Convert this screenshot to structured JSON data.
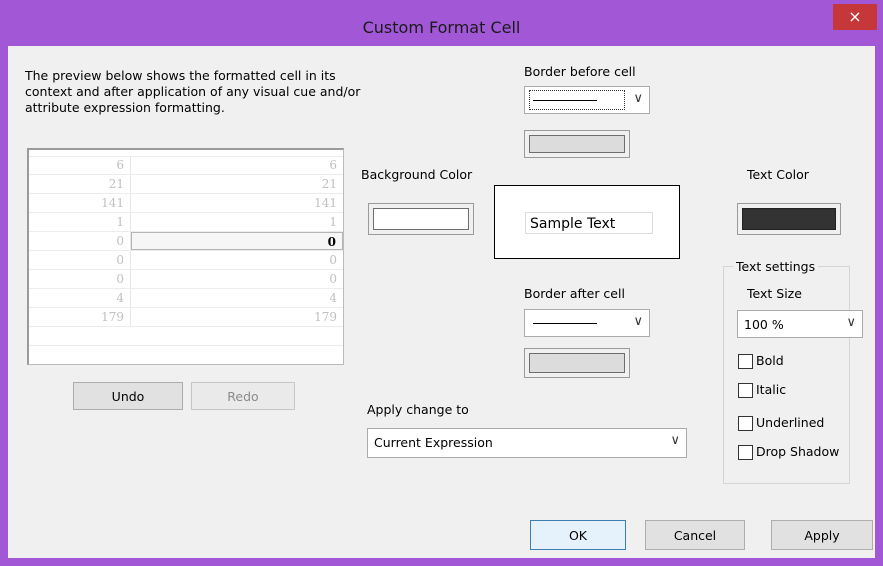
{
  "window": {
    "title": "Custom Format Cell",
    "close_icon": "×"
  },
  "description": "The preview below shows the formatted cell in its context and after application of any visual cue and/or attribute expression formatting.",
  "preview": {
    "rows": [
      {
        "c1": "6",
        "c2": "6"
      },
      {
        "c1": "21",
        "c2": "21"
      },
      {
        "c1": "141",
        "c2": "141"
      },
      {
        "c1": "1",
        "c2": "1"
      },
      {
        "c1": "0",
        "c2": "0",
        "selected": true
      },
      {
        "c1": "0",
        "c2": "0"
      },
      {
        "c1": "0",
        "c2": "0"
      },
      {
        "c1": "4",
        "c2": "4"
      },
      {
        "c1": "179",
        "c2": "179"
      }
    ]
  },
  "buttons": {
    "undo": "Undo",
    "redo": "Redo",
    "ok": "OK",
    "cancel": "Cancel",
    "apply": "Apply"
  },
  "border_before": {
    "label": "Border before cell"
  },
  "border_after": {
    "label": "Border after cell"
  },
  "background": {
    "label": "Background Color",
    "color": "#ffffff"
  },
  "text_color": {
    "label": "Text Color",
    "color": "#333333"
  },
  "sample": {
    "text": "Sample Text"
  },
  "apply_change": {
    "label": "Apply change to",
    "value": "Current Expression"
  },
  "text_settings": {
    "title": "Text settings",
    "size_label": "Text Size",
    "size_value": "100 %",
    "bold": "Bold",
    "italic": "Italic",
    "underlined": "Underlined",
    "drop_shadow": "Drop Shadow"
  }
}
